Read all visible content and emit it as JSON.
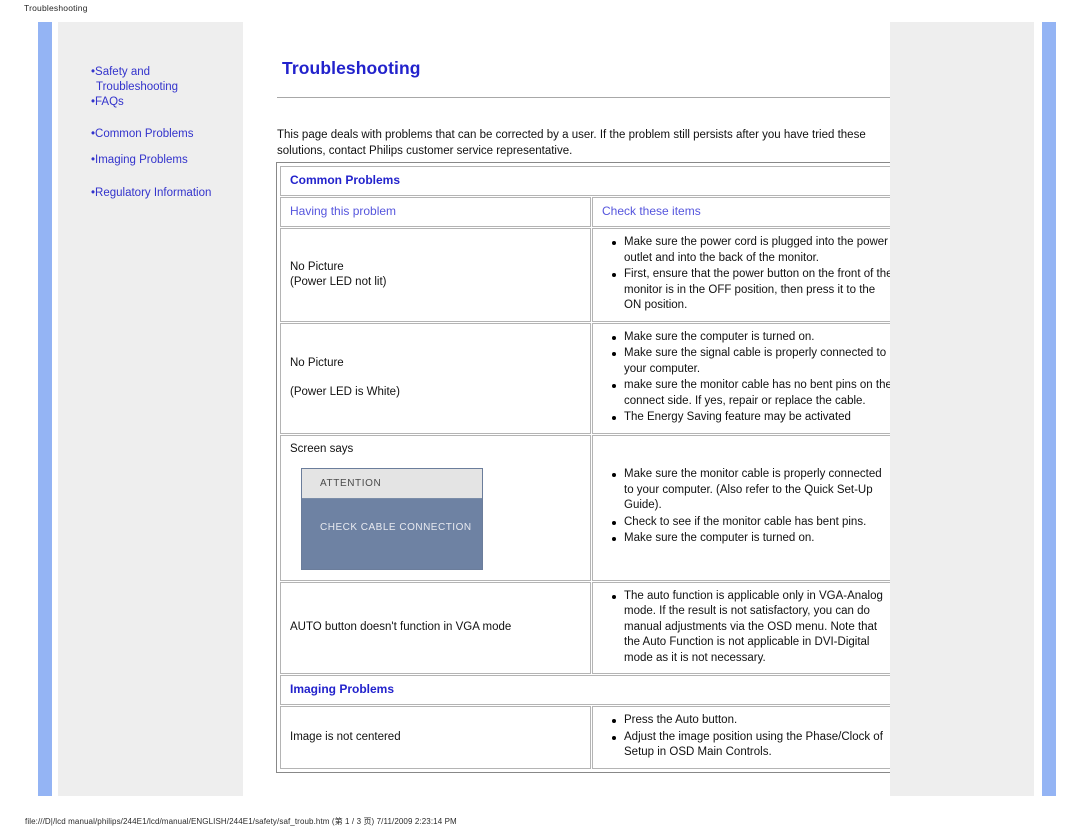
{
  "print": {
    "header": "Troubleshooting",
    "footer": "file:///D|/lcd manual/philips/244E1/lcd/manual/ENGLISH/244E1/safety/saf_troub.htm (第 1 / 3 页) 7/11/2009 2:23:14 PM"
  },
  "colors": {
    "link": "#3333cc",
    "heading": "#2222cc",
    "rail": "#94b4f4",
    "sidebar_bg": "#eeeeee",
    "attention_head_bg": "#e4e4e4",
    "attention_body_bg": "#6e82a3"
  },
  "sidebar": {
    "groups": [
      {
        "items": [
          {
            "bullet": "•",
            "label": "Safety and",
            "sub": "Troubleshooting"
          },
          {
            "bullet": "•",
            "label": "FAQs",
            "sub": ""
          }
        ]
      },
      {
        "items": [
          {
            "bullet": "•",
            "label": "Common Problems",
            "sub": ""
          },
          {
            "bullet": "•",
            "label": "Imaging Problems",
            "sub": ""
          }
        ]
      },
      {
        "items": [
          {
            "bullet": "•",
            "label": "Regulatory Information",
            "sub": ""
          }
        ]
      }
    ]
  },
  "main": {
    "title": "Troubleshooting",
    "intro": "This page deals with problems that can be corrected by a user. If the problem still persists after you have tried these solutions, contact Philips customer service representative.",
    "sections": [
      {
        "name": "common-problems",
        "heading": "Common Problems",
        "columns": {
          "a": "Having this problem",
          "b": "Check these items"
        },
        "rows": [
          {
            "problem_lines": [
              "No Picture",
              "(Power LED not lit)"
            ],
            "gap_after_first": false,
            "checks": [
              "Make sure the power cord is plugged into the power outlet and into the back of the monitor.",
              "First, ensure that the power button on the front of the monitor is in the OFF position, then press it to the ON position."
            ]
          },
          {
            "problem_lines": [
              "No Picture",
              "(Power LED is White)"
            ],
            "gap_after_first": true,
            "checks": [
              "Make sure the computer is turned on.",
              "Make sure the signal cable is properly connected to your computer.",
              "make sure the monitor cable has no bent pins on the connect side. If yes, repair or replace the cable.",
              "The Energy Saving feature may be activated"
            ]
          },
          {
            "problem_lines": [
              "Screen says"
            ],
            "gap_after_first": false,
            "attention": {
              "head": "ATTENTION",
              "body": "CHECK CABLE CONNECTION"
            },
            "checks": [
              "Make sure the monitor cable is properly connected to your computer. (Also refer to the Quick Set-Up Guide).",
              "Check to see if the monitor cable has bent pins.",
              "Make sure the computer is turned on."
            ]
          },
          {
            "problem_lines": [
              "AUTO button doesn't function in VGA mode"
            ],
            "gap_after_first": false,
            "checks": [
              "The auto function is applicable only in VGA-Analog mode.  If the result is not satisfactory, you can do manual adjustments via the OSD menu.  Note that the Auto Function is not applicable in DVI-Digital mode as it is not necessary."
            ]
          }
        ]
      },
      {
        "name": "imaging-problems",
        "heading": "Imaging Problems",
        "columns": {
          "a": "",
          "b": ""
        },
        "rows": [
          {
            "problem_lines": [
              "Image is not centered"
            ],
            "gap_after_first": false,
            "checks": [
              "Press the Auto button.",
              "Adjust the image position using the Phase/Clock of Setup in OSD Main Controls."
            ]
          }
        ]
      }
    ]
  }
}
